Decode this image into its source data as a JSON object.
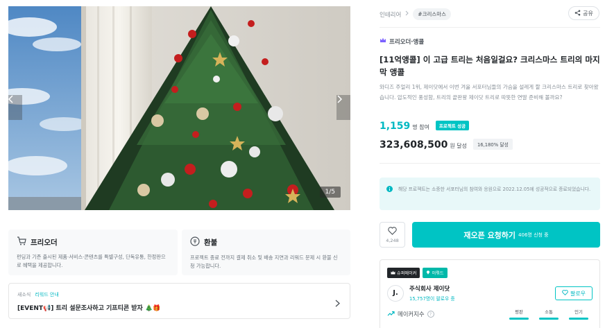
{
  "gallery": {
    "counter": "1/5"
  },
  "cards": {
    "preorder": {
      "title": "프리오더",
      "desc": "펀딩과 기존 출시된 제품·서비스·콘텐츠를 특별구성, 단독유통, 한정판으로 혜택을 제공합니다."
    },
    "refund": {
      "title": "환불",
      "desc": "프로젝트 종료 전까지 결제 취소 및 배송 지연과 리워드 문제 시 환불 신청 가능합니다."
    }
  },
  "notice": {
    "tag1": "새소식",
    "tag2": "리워드 안내",
    "title": "[EVENT📢] 트리 설문조사하고 기프티콘 받자 🎄🎁"
  },
  "breadcrumb": {
    "category": "인테리어",
    "tag": "#크리스마스"
  },
  "share_label": "공유",
  "badge_line": "프리오더·앵콜",
  "project": {
    "title": "[11억앵콜] 이 고급 트리는 처음일걸요? 크리스마스 트리의 마지막 앵콜",
    "description": "와디즈 주얼리 1위, 제이닷에서 이번 겨울 서포터님들의 가슴을 설레게 할 크리스마스 트리로 찾아왔습니다. 압도적인 풍성함, 트리의 끝판왕 제이닷 트리로 따뜻한 연말 준비해 볼까요?"
  },
  "stats": {
    "participants": "1,159",
    "participants_unit": "명 참여",
    "success_badge": "프로젝트 성공",
    "amount": "323,608,500",
    "amount_unit": "원 달성",
    "percent": "16,180% 달성"
  },
  "info_banner": {
    "text": "해당 프로젝트는 소중한 서포터님의 참여와 응원으로 2022.12.05에 성공적으로 종료되었습니다."
  },
  "like": {
    "count": "4,248"
  },
  "request_button": {
    "label": "재오픈 요청하기",
    "sub": "406명 신청 중"
  },
  "maker": {
    "badge_super": "슈퍼메이커",
    "badge_follow": "이뤄드",
    "logo_text": "J.",
    "name": "주식회사 제이닷",
    "followers": "15,757명이 팔로우 중",
    "follow_label": "팔로우",
    "index_label": "메이커지수",
    "metrics": [
      "평판",
      "소통",
      "인기"
    ]
  },
  "colors": {
    "accent": "#00c4c4",
    "accent_text": "#00b8c2"
  }
}
